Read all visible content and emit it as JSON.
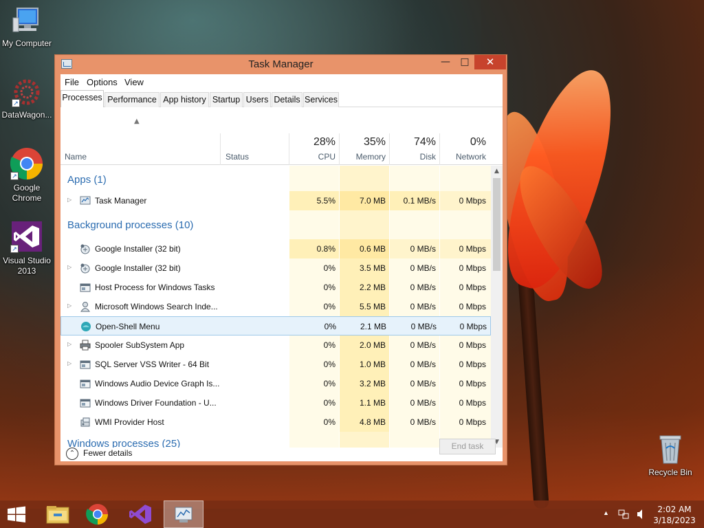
{
  "desktop": {
    "icons": [
      {
        "label": "My Computer"
      },
      {
        "label": "DataWagon..."
      },
      {
        "label": "Google\nChrome"
      },
      {
        "label": "Visual Studio\n2013"
      },
      {
        "label": "Recycle Bin"
      }
    ]
  },
  "window": {
    "title": "Task Manager",
    "controls": {
      "minimize": "—",
      "maximize": "□",
      "close": "✕"
    },
    "menu": [
      "File",
      "Options",
      "View"
    ],
    "tabs": [
      "Processes",
      "Performance",
      "App history",
      "Startup",
      "Users",
      "Details",
      "Services"
    ],
    "active_tab": "Processes",
    "columns": {
      "name": "Name",
      "status": "Status",
      "cpu": {
        "pct": "28%",
        "label": "CPU"
      },
      "memory": {
        "pct": "35%",
        "label": "Memory"
      },
      "disk": {
        "pct": "74%",
        "label": "Disk"
      },
      "network": {
        "pct": "0%",
        "label": "Network"
      }
    },
    "groups": [
      {
        "title": "Apps (1)"
      },
      {
        "title": "Background processes (10)"
      },
      {
        "title": "Windows processes (25)"
      }
    ],
    "apps": [
      {
        "name": "Task Manager",
        "cpu": "5.5%",
        "memory": "7.0 MB",
        "disk": "0.1 MB/s",
        "network": "0 Mbps",
        "expandable": true,
        "icon": "task-manager-icon"
      }
    ],
    "background": [
      {
        "name": "Google Installer (32 bit)",
        "cpu": "0.8%",
        "memory": "0.6 MB",
        "disk": "0 MB/s",
        "network": "0 Mbps",
        "expandable": false,
        "icon": "google-installer-icon"
      },
      {
        "name": "Google Installer (32 bit)",
        "cpu": "0%",
        "memory": "3.5 MB",
        "disk": "0 MB/s",
        "network": "0 Mbps",
        "expandable": true,
        "icon": "google-installer-icon"
      },
      {
        "name": "Host Process for Windows Tasks",
        "cpu": "0%",
        "memory": "2.2 MB",
        "disk": "0 MB/s",
        "network": "0 Mbps",
        "expandable": false,
        "icon": "window-app-icon"
      },
      {
        "name": "Microsoft Windows Search Inde...",
        "cpu": "0%",
        "memory": "5.5 MB",
        "disk": "0 MB/s",
        "network": "0 Mbps",
        "expandable": true,
        "icon": "search-user-icon"
      },
      {
        "name": "Open-Shell Menu",
        "cpu": "0%",
        "memory": "2.1 MB",
        "disk": "0 MB/s",
        "network": "0 Mbps",
        "expandable": false,
        "icon": "open-shell-icon",
        "selected": true
      },
      {
        "name": "Spooler SubSystem App",
        "cpu": "0%",
        "memory": "2.0 MB",
        "disk": "0 MB/s",
        "network": "0 Mbps",
        "expandable": true,
        "icon": "printer-icon"
      },
      {
        "name": "SQL Server VSS Writer - 64 Bit",
        "cpu": "0%",
        "memory": "1.0 MB",
        "disk": "0 MB/s",
        "network": "0 Mbps",
        "expandable": true,
        "icon": "window-app-icon"
      },
      {
        "name": "Windows Audio Device Graph Is...",
        "cpu": "0%",
        "memory": "3.2 MB",
        "disk": "0 MB/s",
        "network": "0 Mbps",
        "expandable": false,
        "icon": "window-app-icon"
      },
      {
        "name": "Windows Driver Foundation - U...",
        "cpu": "0%",
        "memory": "1.1 MB",
        "disk": "0 MB/s",
        "network": "0 Mbps",
        "expandable": false,
        "icon": "window-app-icon"
      },
      {
        "name": "WMI Provider Host",
        "cpu": "0%",
        "memory": "4.8 MB",
        "disk": "0 MB/s",
        "network": "0 Mbps",
        "expandable": false,
        "icon": "wmi-icon"
      }
    ],
    "footer": {
      "fewer_details": "Fewer details",
      "end_task": "End task"
    }
  },
  "taskbar": {
    "clock_time": "2:02 AM",
    "clock_date": "3/18/2023"
  },
  "colors": {
    "accent_window": "#e8936a",
    "group_text": "#2b6cb0",
    "heat": "#fff4cc",
    "close_button": "#c7432c"
  }
}
